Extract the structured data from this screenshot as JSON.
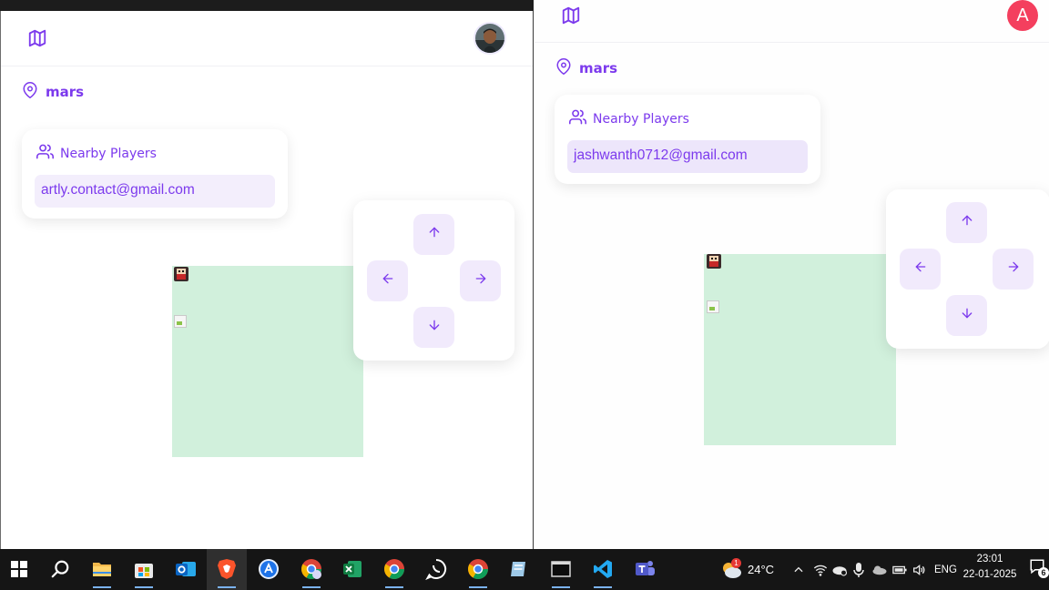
{
  "left_window": {
    "location": "mars",
    "nearby_title": "Nearby Players",
    "players": [
      "artly.contact@gmail.com"
    ]
  },
  "right_window": {
    "avatar_initial": "A",
    "location": "mars",
    "nearby_title": "Nearby Players",
    "players": [
      "jashwanth0712@gmail.com"
    ]
  },
  "colors": {
    "accent": "#7c3aed",
    "chip_bg": "#f3eefc",
    "world_bg": "#d1f0dc",
    "avatar_red": "#f43f5e"
  },
  "icons": {
    "header": "map-icon",
    "location": "map-pin-icon",
    "players": "users-icon",
    "dpad": [
      "arrow-up-icon",
      "arrow-left-icon",
      "arrow-right-icon",
      "arrow-down-icon"
    ]
  },
  "taskbar": {
    "weather_temp": "24°C",
    "weather_badge": "1",
    "language": "ENG",
    "time": "23:01",
    "date": "22-01-2025",
    "notification_count": "6"
  }
}
